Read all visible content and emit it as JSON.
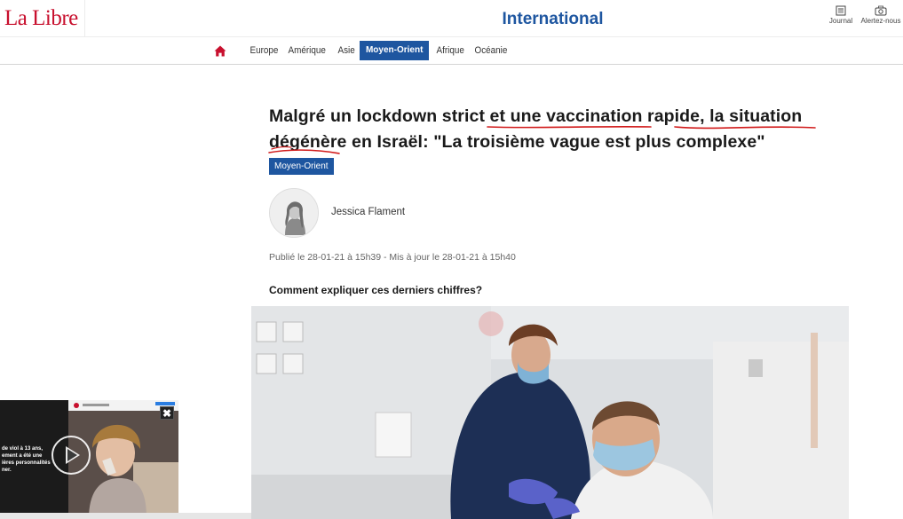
{
  "header": {
    "logo": "La Libre",
    "section_title": "International",
    "tools": [
      {
        "label": "Journal",
        "icon": "newspaper-icon"
      },
      {
        "label": "Alertez-nous",
        "icon": "camera-icon"
      }
    ]
  },
  "nav": {
    "home_icon": "home-icon",
    "items": [
      "Europe",
      "Amérique",
      "Asie",
      "Moyen-Orient",
      "Afrique",
      "Océanie"
    ],
    "active": "Moyen-Orient"
  },
  "article": {
    "headline_parts": [
      "Malgré un lockdown strict et ",
      "une vaccination rapide",
      ", la ",
      "situation dégénère",
      " ",
      "en Israël",
      ": \"La troisième vague est plus complexe\""
    ],
    "category": "Moyen-Orient",
    "author": "Jessica Flament",
    "published": "Publié le 28-01-21 à 15h39 - Mis à jour le 28-01-21 à 15h40",
    "lead": "Comment expliquer ces derniers chiffres?"
  },
  "video": {
    "caption_lines": [
      "de viol à 13 ans,",
      "ement a été une",
      "ières personnalités",
      "ner."
    ],
    "close_label": "✖"
  },
  "colors": {
    "brand_red": "#c8102e",
    "accent_blue": "#1e56a0",
    "underline_red": "#d11a1a"
  }
}
